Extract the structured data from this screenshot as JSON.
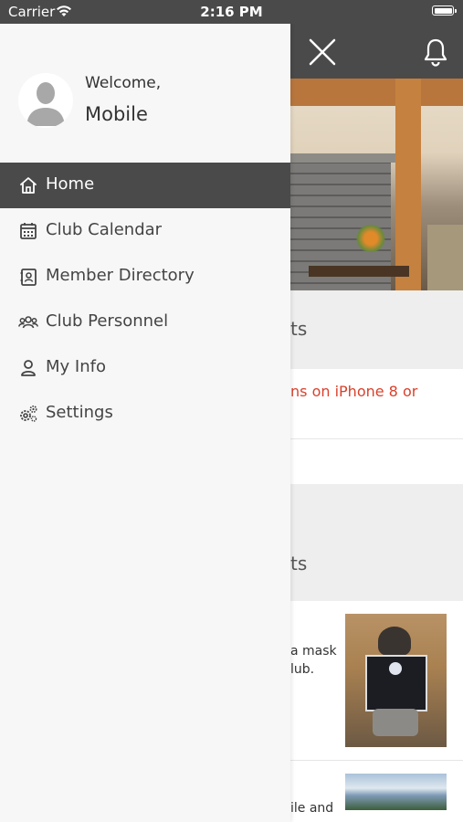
{
  "status_bar": {
    "carrier": "Carrier",
    "time": "2:16 PM"
  },
  "drawer": {
    "welcome": "Welcome,",
    "username": "Mobile",
    "items": [
      {
        "label": "Home",
        "icon": "home-icon",
        "active": true
      },
      {
        "label": "Club Calendar",
        "icon": "calendar-icon",
        "active": false
      },
      {
        "label": "Member Directory",
        "icon": "contact-book-icon",
        "active": false
      },
      {
        "label": "Club Personnel",
        "icon": "group-icon",
        "active": false
      },
      {
        "label": "My Info",
        "icon": "user-icon",
        "active": false
      },
      {
        "label": "Settings",
        "icon": "gears-icon",
        "active": false
      }
    ]
  },
  "background": {
    "section1_title_partial": "ts",
    "alert_partial": "ns on iPhone 8 or",
    "section2_title_partial": "ts",
    "news1_line1_partial": "a mask",
    "news1_line2_partial": "lub.",
    "news2_partial": "ile and"
  },
  "colors": {
    "header_bg": "#4a4a4a",
    "active_item_bg": "#4a4a4a",
    "alert_text": "#d9412c",
    "drawer_bg": "#f7f7f7"
  }
}
